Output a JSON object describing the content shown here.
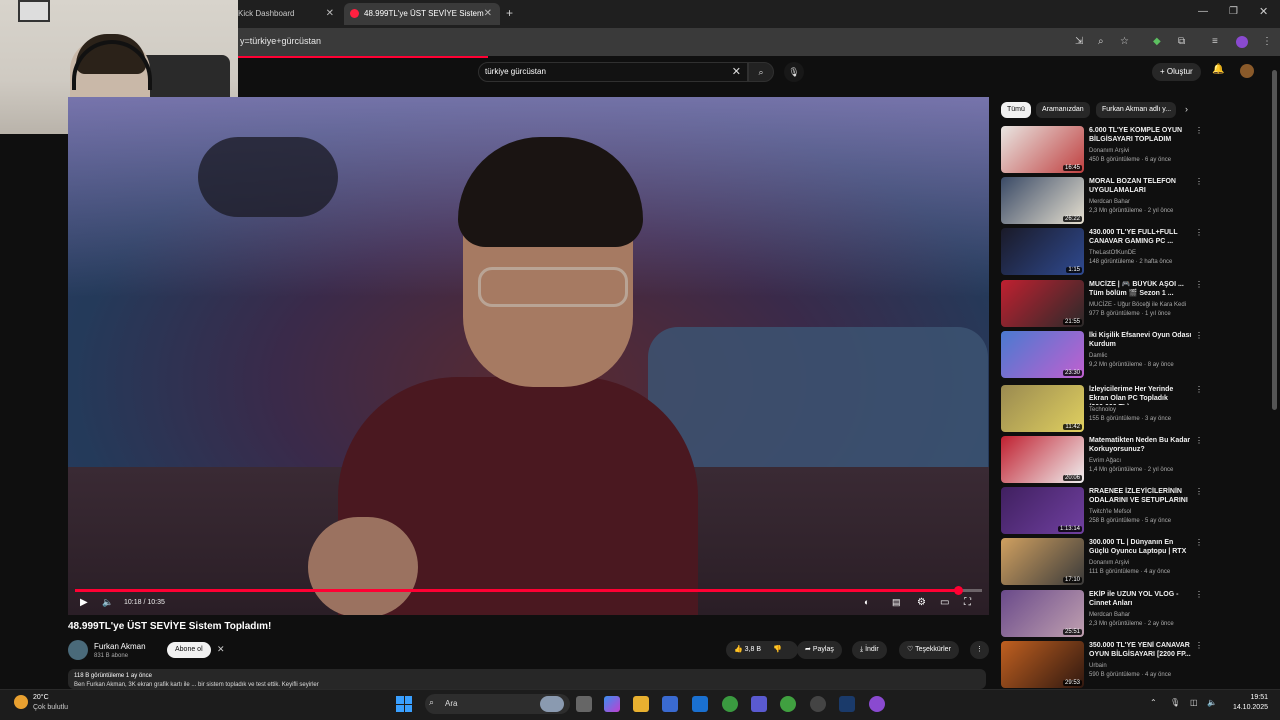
{
  "browser": {
    "tabs": [
      {
        "label": "Kick Dashboard"
      },
      {
        "label": "48.999TL'ye ÜST SEVİYE Sistem"
      }
    ],
    "url": "y=türkiye+gürcüstan"
  },
  "youtube": {
    "search_value": "türkiye gürcüstan",
    "create_label": "Oluştur"
  },
  "player": {
    "timecode": "10:18 / 10:35",
    "progress": 0.973
  },
  "video": {
    "title": "48.999TL'ye ÜST SEVİYE Sistem Topladım!",
    "channel": "Furkan Akman",
    "subscribers": "831 B abone",
    "subscribe_label": "Abone ol",
    "likes": "3,8 B",
    "share_label": "Paylaş",
    "download_label": "İndir",
    "thanks_label": "Teşekkürler",
    "desc_meta": "118 B görüntüleme  1 ay önce",
    "desc_text": "Ben Furkan Akman, 3K ekran grafik  kartı  ile  ... bir sistem topladık ve  test ettik. Keyifli seyirler"
  },
  "chips": [
    "Tümü",
    "Aramanızdan",
    "Furkan Akman adlı y..."
  ],
  "recommendations": [
    {
      "title": "6.000 TL'YE KOMPLE OYUN BİLGİSAYARI TOPLADIM",
      "channel": "Donanım Arşivi",
      "views": "450 B görüntüleme · 6 ay önce",
      "duration": "16:45",
      "c1": "#e9e6e2",
      "c2": "#c04040"
    },
    {
      "title": "MORAL BOZAN TELEFON UYGULAMALARI",
      "channel": "Merdcan Bahar",
      "views": "2,3 Mn görüntüleme · 2 yıl önce",
      "duration": "26:22",
      "c1": "#3a4a66",
      "c2": "#e6e0d0"
    },
    {
      "title": "430.000 TL'YE FULL+FULL CANAVAR GAMING PC ...",
      "channel": "TheLastOfKunDE",
      "views": "148 görüntüleme · 2 hafta önce",
      "duration": "1:15",
      "c1": "#1a1a28",
      "c2": "#2f4a90"
    },
    {
      "title": "MUCİZE | 🎮 BÜYÜK AŞOI ... Tüm bölüm 🎬 Sezon 1 ...",
      "channel": "MUCİZE - Uğur Böceği ile Kara Kedi",
      "views": "977 B görüntüleme · 1 yıl önce",
      "duration": "21:55",
      "c1": "#c02030",
      "c2": "#2a2a2a"
    },
    {
      "title": "İki Kişilik Efsanevi Oyun Odası Kurdum",
      "channel": "Damlic",
      "views": "9,2 Mn görüntüleme · 8 ay önce",
      "duration": "23:30",
      "c1": "#4a7ad0",
      "c2": "#c060d0"
    },
    {
      "title": "İzleyicilerime Her Yerinde Ekran Olan PC Topladık (200.000 TL)",
      "channel": "Technoloy",
      "views": "155 B görüntüleme · 3 ay önce",
      "duration": "11:42",
      "c1": "#9a8a50",
      "c2": "#e0d060"
    },
    {
      "title": "Matematikten Neden Bu Kadar Korkuyorsunuz?",
      "channel": "Evrim Ağacı",
      "views": "1,4 Mn görüntüleme · 2 yıl önce",
      "duration": "20:06",
      "c1": "#c02030",
      "c2": "#f0f0f0"
    },
    {
      "title": "RRAENEE İZLEYİCİLERİNİN ODALARINI VE SETUPLARINI ...",
      "channel": "Twitch'le Mefsol",
      "views": "258 B görüntüleme · 5 ay önce",
      "duration": "1:13:14",
      "c1": "#402060",
      "c2": "#7040a0"
    },
    {
      "title": "300.000 TL | Dünyanın En Güçlü Oyuncu Laptopu | RTX ...",
      "channel": "Donanım Arşivi",
      "views": "111 B görüntüleme · 4 ay önce",
      "duration": "17:10",
      "c1": "#d0a060",
      "c2": "#3a3a3a"
    },
    {
      "title": "EKİP ile UZUN YOL VLOG - Cinnet Anları",
      "channel": "Merdcan Bahar",
      "views": "2,3 Mn görüntüleme · 2 ay önce",
      "duration": "25:51",
      "c1": "#6a4a8a",
      "c2": "#c0a0b0"
    },
    {
      "title": "350.000 TL'YE YENİ CANAVAR OYUN BİLGİSAYARI [2200 FP...",
      "channel": "Urbain",
      "views": "590 B görüntüleme · 4 ay önce",
      "duration": "29:53",
      "c1": "#c06020",
      "c2": "#301810"
    }
  ],
  "taskbar": {
    "temp": "20°C",
    "weather": "Çok bulutlu",
    "search_label": "Ara",
    "time": "19:51",
    "date": "14.10.2025"
  },
  "icons": {
    "play": "▶",
    "volume": "🔈",
    "search": "⌕",
    "close": "✕",
    "mic": "🎙",
    "bell": "🔔",
    "more": "⋮",
    "like": "👍",
    "dislike": "👎",
    "share": "➦",
    "download": "⤓",
    "plus": "+"
  }
}
